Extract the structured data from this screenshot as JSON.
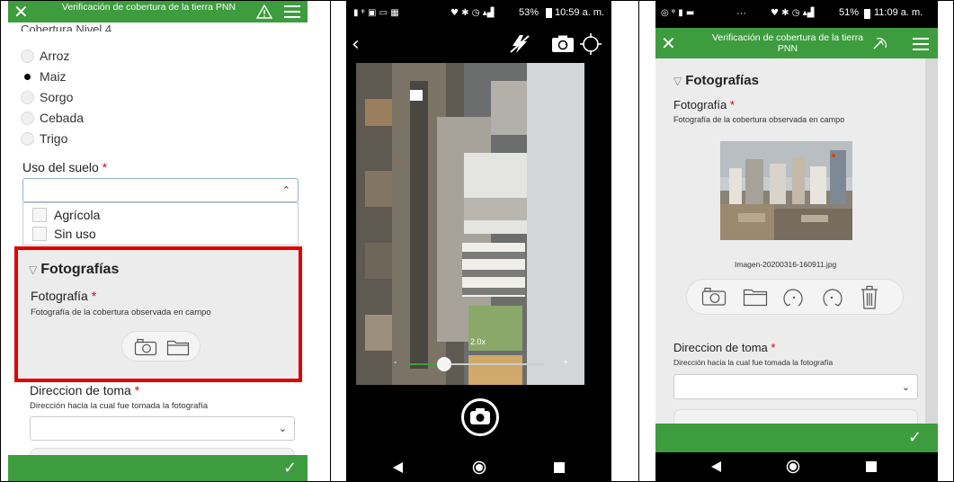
{
  "panel1": {
    "app_title": "Verificación de cobertura de la tierra PNN",
    "partial_label": "Cobertura Nivel 4",
    "radio_options": [
      "Arroz",
      "Maiz",
      "Sorgo",
      "Cebada",
      "Trigo"
    ],
    "selected_option": "Maiz",
    "uso_label": "Uso del suelo",
    "required_mark": "*",
    "uso_options": [
      "Agrícola",
      "Sin uso"
    ],
    "section_title": "Fotografías",
    "foto_label": "Fotografía",
    "foto_hint": "Fotografía de la cobertura observada en campo",
    "direccion_label": "Direccion de toma",
    "direccion_hint": "Dirección hacia la cual fue tomada la fotografía"
  },
  "panel2": {
    "status_time": "10:59 a. m.",
    "status_battery": "53%",
    "zoom_level": "2.0x",
    "zoom_minus": "-",
    "zoom_plus": "+"
  },
  "panel3": {
    "status_time": "11:09 a. m.",
    "status_battery": "51%",
    "status_more": "···",
    "app_title": "Verificación de cobertura de la tierra PNN",
    "section_title": "Fotografías",
    "foto_label": "Fotografía",
    "required_mark": "*",
    "foto_hint": "Fotografía de la cobertura observada en campo",
    "image_filename": "Imagen-20200316-160911.jpg",
    "direccion_label": "Direccion de toma",
    "direccion_hint": "Dirección hacia la cual fue tomada la fotografía"
  },
  "colors": {
    "app_green": "#3d9c3d",
    "highlight_red": "#e00000",
    "required_red": "#d9001b"
  }
}
